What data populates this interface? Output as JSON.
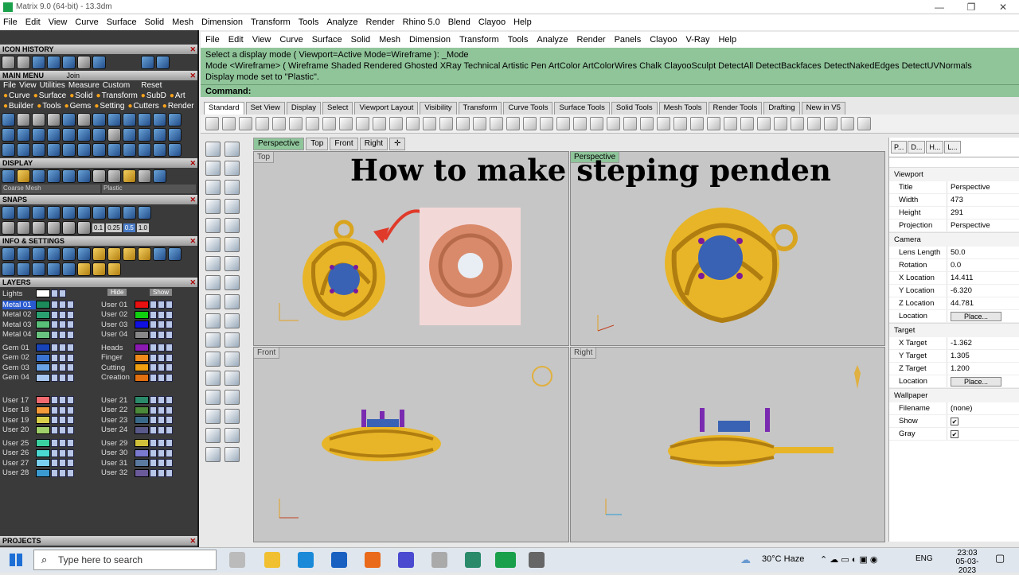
{
  "window": {
    "title": "Matrix 9.0 (64-bit) - 13.3dm"
  },
  "menu_main": [
    "File",
    "Edit",
    "View",
    "Curve",
    "Surface",
    "Solid",
    "Mesh",
    "Dimension",
    "Transform",
    "Tools",
    "Analyze",
    "Render",
    "Rhino 5.0",
    "Blend",
    "Clayoo",
    "Help"
  ],
  "menu_rhino": [
    "File",
    "Edit",
    "View",
    "Curve",
    "Surface",
    "Solid",
    "Mesh",
    "Dimension",
    "Transform",
    "Tools",
    "Analyze",
    "Render",
    "Panels",
    "Clayoo",
    "V-Ray",
    "Help"
  ],
  "left": {
    "icon_history": "ICON HISTORY",
    "main_menu": "MAIN MENU",
    "join": "Join",
    "mm_row1": [
      "File",
      "View",
      "Utilities",
      "Measure",
      "Custom",
      "Reset"
    ],
    "mm_row2": [
      "Curve",
      "Surface",
      "Solid",
      "Transform",
      "SubD",
      "Art"
    ],
    "mm_row3": [
      "Builder",
      "Tools",
      "Gems",
      "Setting",
      "Cutters",
      "Render"
    ],
    "display": "DISPLAY",
    "mesh_select": "Coarse Mesh",
    "plastic_select": "Plastic",
    "snaps": "SNAPS",
    "snap_vals": [
      "0.1",
      "0.25",
      "0.5",
      "1.0"
    ],
    "info": "INFO & SETTINGS",
    "layers": "LAYERS",
    "lights": "Lights",
    "hide": "Hide",
    "show": "Show",
    "projects": "PROJECTS",
    "layers_left": [
      {
        "n": "Metal 01",
        "c": "#1c8a5a"
      },
      {
        "n": "Metal 02",
        "c": "#2aa070"
      },
      {
        "n": "Metal 03",
        "c": "#59c07a"
      },
      {
        "n": "Metal 04",
        "c": "#69c480"
      },
      {
        "n": "Gem 01",
        "c": "#1844b8"
      },
      {
        "n": "Gem 02",
        "c": "#3a74d0"
      },
      {
        "n": "Gem 03",
        "c": "#6aa2e6"
      },
      {
        "n": "Gem 04",
        "c": "#a8c8f0"
      },
      {
        "n": "User 17",
        "c": "#f06a70"
      },
      {
        "n": "User 18",
        "c": "#f49a3a"
      },
      {
        "n": "User 19",
        "c": "#d8d04a"
      },
      {
        "n": "User 20",
        "c": "#a0d06a"
      },
      {
        "n": "User 25",
        "c": "#3ad0a0"
      },
      {
        "n": "User 26",
        "c": "#4ad8d0"
      },
      {
        "n": "User 27",
        "c": "#7ad0f0"
      },
      {
        "n": "User 28",
        "c": "#3a9ad0"
      }
    ],
    "layers_right": [
      {
        "n": "User 01",
        "c": "#e81010"
      },
      {
        "n": "User 02",
        "c": "#10d010"
      },
      {
        "n": "User 03",
        "c": "#1010e0"
      },
      {
        "n": "User 04",
        "c": "#888888"
      },
      {
        "n": "Heads",
        "c": "#8a1ab0"
      },
      {
        "n": "Finger",
        "c": "#f08a1a"
      },
      {
        "n": "Cutting",
        "c": "#f0a010"
      },
      {
        "n": "Creation",
        "c": "#e07010"
      },
      {
        "n": "User 21",
        "c": "#2a8a6a"
      },
      {
        "n": "User 22",
        "c": "#4a8a3a"
      },
      {
        "n": "User 23",
        "c": "#3a6a8a"
      },
      {
        "n": "User 24",
        "c": "#5a5a8a"
      },
      {
        "n": "User 29",
        "c": "#d0c03a"
      },
      {
        "n": "User 30",
        "c": "#7a7ad0"
      },
      {
        "n": "User 31",
        "c": "#5a7aa0"
      },
      {
        "n": "User 32",
        "c": "#6a5a9a"
      }
    ]
  },
  "command": {
    "line1": "Select a display mode ( Viewport=Active  Mode=Wireframe ): _Mode",
    "line2": "Mode <Wireframe> ( Wireframe  Shaded  Rendered  Ghosted  XRay  Technical  Artistic  Pen  ArtColor  ArtColorWires  Chalk  ClayooSculpt  DetectAll  DetectBackfaces  DetectNakedEdges  DetectUVNormals",
    "line3": "Display mode set to \"Plastic\".",
    "prompt": "Command:"
  },
  "toolbar_tabs": [
    "Standard",
    "Set View",
    "Display",
    "Select",
    "Viewport Layout",
    "Visibility",
    "Transform",
    "Curve Tools",
    "Surface Tools",
    "Solid Tools",
    "Mesh Tools",
    "Render Tools",
    "Drafting",
    "New in V5"
  ],
  "viewport_tabs": [
    "Perspective",
    "Top",
    "Front",
    "Right"
  ],
  "viewports": {
    "top": "Top",
    "perspective": "Perspective",
    "front": "Front",
    "right": "Right"
  },
  "headline": "How to make  steping penden",
  "properties": {
    "tabs": [
      "P...",
      "D...",
      "H...",
      "L..."
    ],
    "viewport_group": "Viewport",
    "viewport": [
      [
        "Title",
        "Perspective"
      ],
      [
        "Width",
        "473"
      ],
      [
        "Height",
        "291"
      ],
      [
        "Projection",
        "Perspective"
      ]
    ],
    "camera_group": "Camera",
    "camera": [
      [
        "Lens Length",
        "50.0"
      ],
      [
        "Rotation",
        "0.0"
      ],
      [
        "X Location",
        "14.411"
      ],
      [
        "Y Location",
        "-6.320"
      ],
      [
        "Z Location",
        "44.781"
      ]
    ],
    "location_label": "Location",
    "place_btn": "Place...",
    "target_group": "Target",
    "target": [
      [
        "X Target",
        "-1.362"
      ],
      [
        "Y Target",
        "1.305"
      ],
      [
        "Z Target",
        "1.200"
      ]
    ],
    "wallpaper_group": "Wallpaper",
    "filename_label": "Filename",
    "filename_value": "(none)",
    "show_label": "Show",
    "gray_label": "Gray"
  },
  "taskbar": {
    "search": "Type here to search",
    "weather": "30°C  Haze",
    "lang": "ENG",
    "time": "23:03",
    "date": "05-03-2023"
  }
}
